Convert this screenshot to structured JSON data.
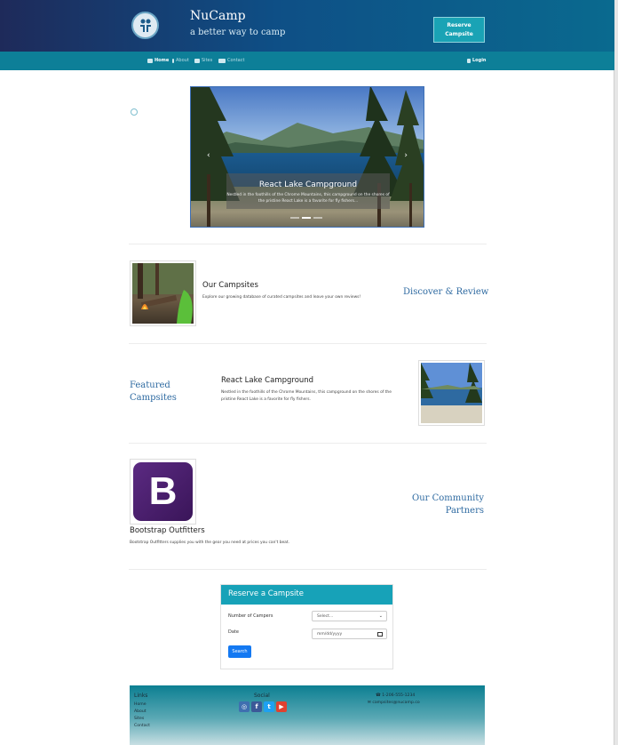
{
  "header": {
    "brand": "NuCamp",
    "tagline": "a better way to camp",
    "reserve_button": "Reserve Campsite"
  },
  "nav": {
    "items": [
      {
        "label": "Home",
        "icon": "home-icon"
      },
      {
        "label": "About",
        "icon": "info-icon"
      },
      {
        "label": "Sites",
        "icon": "list-icon"
      },
      {
        "label": "Contact",
        "icon": "address-card-icon"
      }
    ],
    "login": "Login"
  },
  "carousel": {
    "title": "React Lake Campground",
    "text": "Nestled in the foothills of the Chrome Mountains, this campground on the shores of the pristine React Lake is a favorite for fly fishers..."
  },
  "campsites": {
    "title": "Our Campsites",
    "text": "Explore our growing database of curated campsites and leave your own reviews!",
    "side_heading": "Discover & Review"
  },
  "featured": {
    "side_heading_1": "Featured",
    "side_heading_2": "Campsites",
    "title": "React Lake Campground",
    "text_line1": "Nestled in the foothills of the Chrome Mountains, this campground on the shores of the",
    "text_line2": "pristine React Lake is a favorite for fly fishers."
  },
  "partners": {
    "title": "Bootstrap Outfitters",
    "text": "Bootstrap Outfitters supplies you with the gear you need at prices you can't beat.",
    "side_heading_1": "Our Community",
    "side_heading_2": "Partners",
    "logo_letter": "B"
  },
  "form": {
    "heading": "Reserve a Campsite",
    "campers_label": "Number of Campers",
    "campers_value": "Select...",
    "date_label": "Date",
    "date_placeholder": "mm/dd/yyyy",
    "search_button": "Search"
  },
  "footer": {
    "links_heading": "Links",
    "links": [
      "Home",
      "About",
      "Sites",
      "Contact"
    ],
    "social_heading": "Social",
    "phone": "1-206-555-1234",
    "email": "campsites@nucamp.co"
  },
  "colors": {
    "header_dark": "#1e2a5a",
    "nav": "#0d7f98",
    "accent": "#17a2b8",
    "heading_blue": "#2e6aa1",
    "button_blue": "#1479f2"
  }
}
